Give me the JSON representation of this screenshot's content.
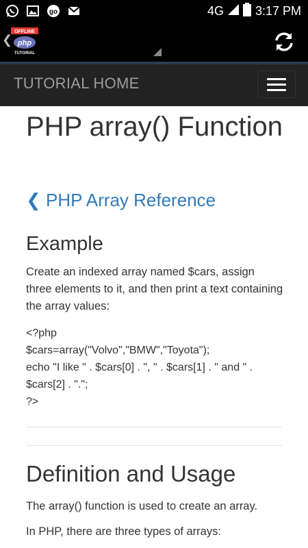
{
  "status_bar": {
    "network": "4G",
    "time": "3:17 PM",
    "notification_icons": [
      "whatsapp-icon",
      "image-icon",
      "go-icon",
      "gmail-icon"
    ]
  },
  "app_bar": {
    "logo_badge": "OFFLINE",
    "logo_text": "php",
    "logo_sub": "TUTORIAL",
    "title": "PHP TUTORIAL"
  },
  "nav": {
    "title": "TUTORIAL HOME"
  },
  "page": {
    "heading": "PHP array() Function",
    "back_link": "❮ PHP Array Reference",
    "example_heading": "Example",
    "example_text": "Create an indexed array named $cars, assign three elements to it, and then print a text containing the array values:",
    "code": "<?php\n$cars=array(\"Volvo\",\"BMW\",\"Toyota\");\necho \"I like \" . $cars[0] . \", \" . $cars[1] . \" and \" .\n$cars[2] . \".\";\n?>",
    "definition_heading": "Definition and Usage",
    "definition_text": "The array() function is used to create an array.",
    "types_text": "In PHP, there are three types of arrays:"
  },
  "colors": {
    "link": "#337ab7",
    "navbar": "#222222",
    "text": "#333333"
  }
}
